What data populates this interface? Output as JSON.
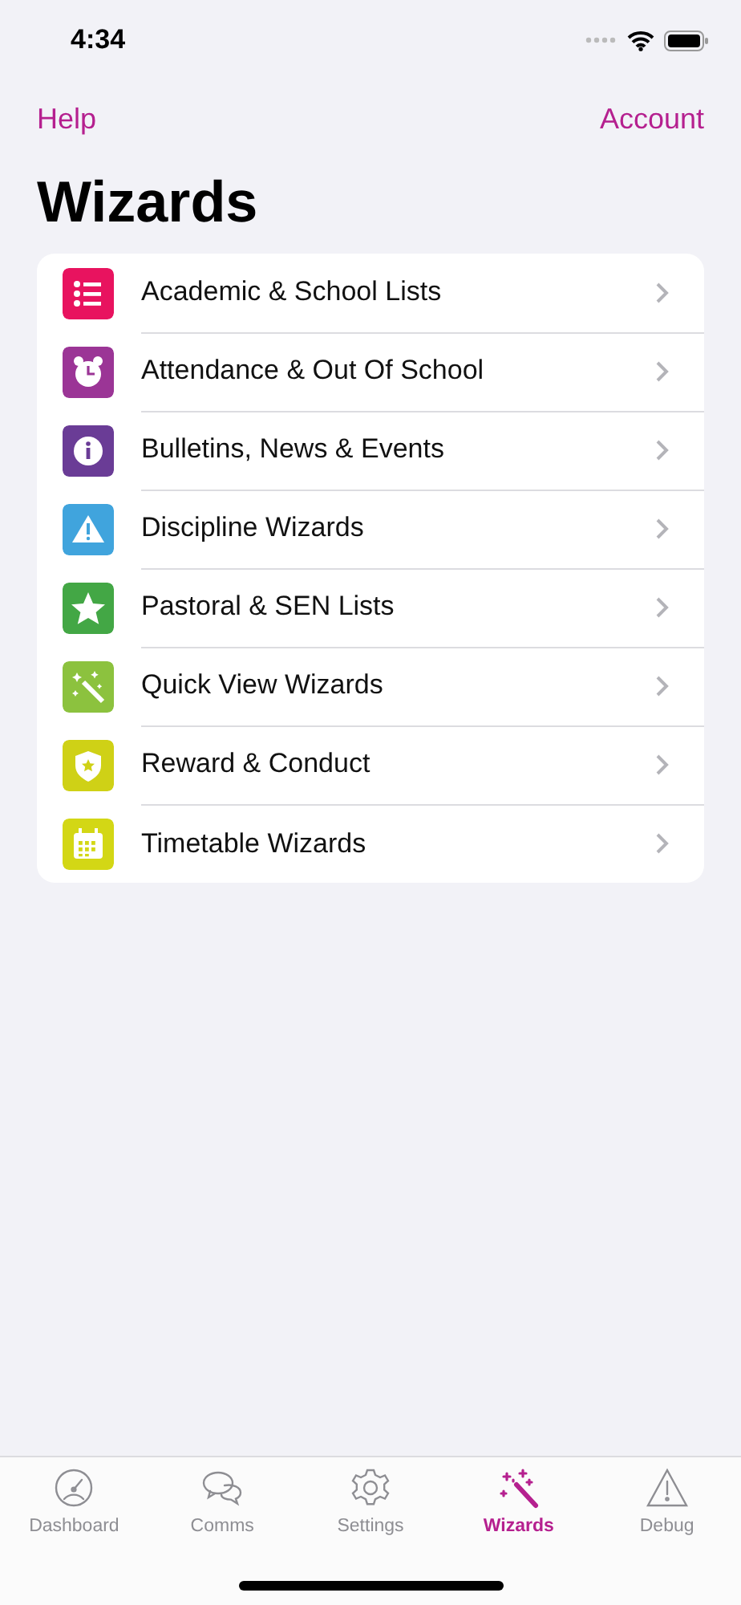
{
  "status_bar": {
    "time": "4:34"
  },
  "nav": {
    "left": "Help",
    "right": "Account"
  },
  "title": "Wizards",
  "items": [
    {
      "label": "Academic & School Lists",
      "kind": "list",
      "color": "#e8135f"
    },
    {
      "label": "Attendance & Out Of School",
      "kind": "alarm",
      "color": "#9b3596"
    },
    {
      "label": "Bulletins, News & Events",
      "kind": "info",
      "color": "#6a3c96"
    },
    {
      "label": "Discipline Wizards",
      "kind": "warning",
      "color": "#40a4dd"
    },
    {
      "label": "Pastoral & SEN Lists",
      "kind": "star",
      "color": "#43a745"
    },
    {
      "label": "Quick View Wizards",
      "kind": "wand",
      "color": "#8cc23e"
    },
    {
      "label": "Reward & Conduct",
      "kind": "shield",
      "color": "#cfd116"
    },
    {
      "label": "Timetable Wizards",
      "kind": "calendar",
      "color": "#d3d715"
    }
  ],
  "tabs": [
    {
      "label": "Dashboard",
      "kind": "dashboard",
      "selected": false
    },
    {
      "label": "Comms",
      "kind": "comms",
      "selected": false
    },
    {
      "label": "Settings",
      "kind": "settings",
      "selected": false
    },
    {
      "label": "Wizards",
      "kind": "wand",
      "selected": true
    },
    {
      "label": "Debug",
      "kind": "warning",
      "selected": false
    }
  ]
}
